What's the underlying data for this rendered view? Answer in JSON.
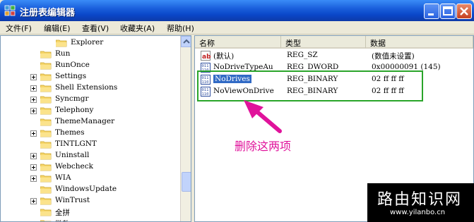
{
  "window": {
    "title": "注册表编辑器"
  },
  "menu": [
    "文件(F)",
    "编辑(E)",
    "查看(V)",
    "收藏夹(A)",
    "帮助(H)"
  ],
  "tree": {
    "items": [
      {
        "label": "Explorer",
        "expander": false
      },
      {
        "label": "Run",
        "expander": false
      },
      {
        "label": "RunOnce",
        "expander": false
      },
      {
        "label": "Settings",
        "expander": true
      },
      {
        "label": "Shell Extensions",
        "expander": true
      },
      {
        "label": "Syncmgr",
        "expander": true
      },
      {
        "label": "Telephony",
        "expander": true
      },
      {
        "label": "ThemeManager",
        "expander": false
      },
      {
        "label": "Themes",
        "expander": true
      },
      {
        "label": "TINTLGNT",
        "expander": false
      },
      {
        "label": "Uninstall",
        "expander": true
      },
      {
        "label": "Webcheck",
        "expander": true
      },
      {
        "label": "WIA",
        "expander": true
      },
      {
        "label": "WindowsUpdate",
        "expander": false
      },
      {
        "label": "WinTrust",
        "expander": true
      },
      {
        "label": "全拼",
        "expander": false
      },
      {
        "label": "微软",
        "expander": false
      }
    ]
  },
  "list": {
    "headers": [
      "名称",
      "类型",
      "数据"
    ],
    "rows": [
      {
        "name": "(默认)",
        "type": "REG_SZ",
        "data": "(数值未设置)",
        "icon": "string-value-icon"
      },
      {
        "name": "NoDriveTypeAu",
        "type": "REG_DWORD",
        "data": "0x00000091 (145)",
        "icon": "binary-value-icon"
      },
      {
        "name": "NoDrives",
        "type": "REG_BINARY",
        "data": "02 ff ff ff",
        "icon": "binary-value-icon"
      },
      {
        "name": "NoViewOnDrive",
        "type": "REG_BINARY",
        "data": "02 ff ff ff",
        "icon": "binary-value-icon"
      }
    ]
  },
  "annotation": {
    "text": "删除这两项",
    "color": "#e0139b"
  },
  "watermark": {
    "title": "路由知识网",
    "url": "www.yilanbo.cn"
  }
}
